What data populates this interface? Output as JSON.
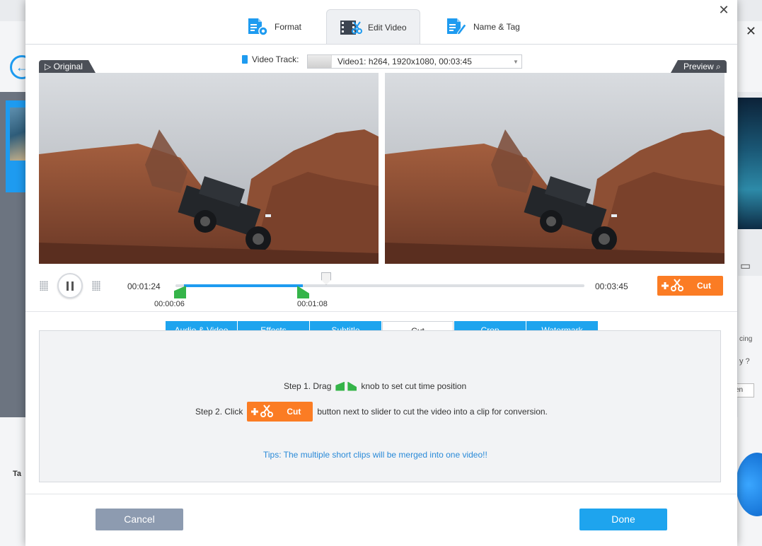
{
  "tabs": [
    {
      "label": "Format",
      "icon": "format-icon",
      "active": false
    },
    {
      "label": "Edit Video",
      "icon": "edit-video-icon",
      "active": true
    },
    {
      "label": "Name & Tag",
      "icon": "name-tag-icon",
      "active": false
    }
  ],
  "video_track": {
    "label": "Video Track:",
    "value": "Video1: h264, 1920x1080, 00:03:45"
  },
  "panes": {
    "original_label": "Original",
    "preview_label": "Preview"
  },
  "playback": {
    "current_time": "00:01:24",
    "total_time": "00:03:45",
    "cut_start": "00:00:06",
    "cut_end": "00:01:08",
    "state": "playing"
  },
  "cut_button": {
    "label": "Cut"
  },
  "sub_tabs": [
    {
      "label": "Audio & Video",
      "active": false
    },
    {
      "label": "Effects",
      "active": false
    },
    {
      "label": "Subtitle",
      "active": false
    },
    {
      "label": "Cut",
      "active": true
    },
    {
      "label": "Crop",
      "active": false
    },
    {
      "label": "Watermark",
      "active": false
    }
  ],
  "instructions": {
    "step1_prefix": "Step 1. Drag",
    "step1_suffix": "knob to set cut time position",
    "step2_prefix": "Step 2. Click",
    "step2_suffix": "button next to slider to cut the video into a clip for conversion.",
    "tips": "Tips: The multiple short clips will be merged into one video!!"
  },
  "buttons": {
    "cancel": "Cancel",
    "done": "Done"
  },
  "background_app": {
    "bottom_left_text": "Ta",
    "right_text_1": "cing",
    "right_text_2": "y ?",
    "right_button": "en"
  },
  "colors": {
    "accent_blue": "#1ea4ee",
    "cut_orange": "#fb7c24",
    "knob_green": "#35b449",
    "cancel_gray": "#8d9bb0"
  }
}
